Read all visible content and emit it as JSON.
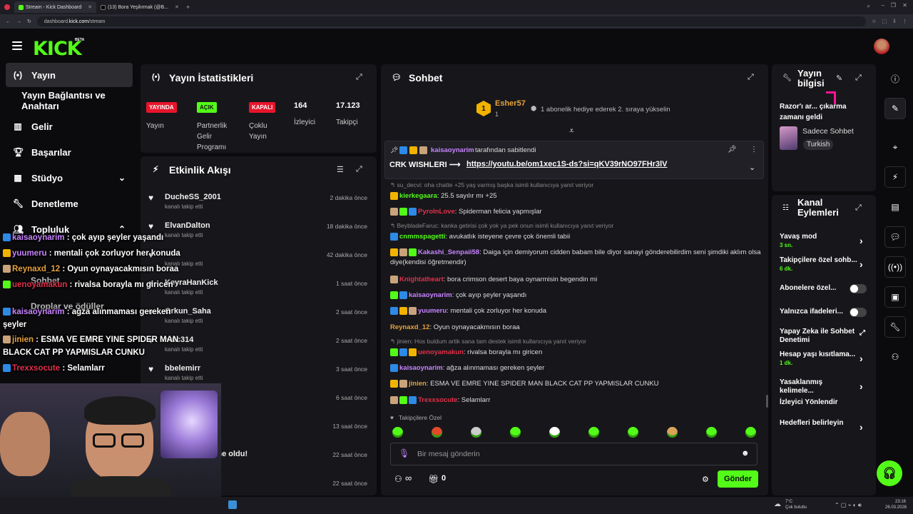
{
  "browser": {
    "tabs": [
      {
        "label": "Stream - Kick Dashboard",
        "active": true
      },
      {
        "label": "(13) Bora Yeşilırmak (@B...",
        "active": false
      }
    ],
    "url_prefix": "dashboard.",
    "url_host": "kick.com",
    "url_path": "/stream"
  },
  "logo": {
    "text": "KICK",
    "beta": "BETA"
  },
  "sidebar": {
    "items": [
      {
        "label": "Yayın",
        "icon": "broadcast-icon"
      },
      {
        "label": "Yayın Bağlantısı ve Anahtarı",
        "icon": ""
      },
      {
        "label": "Gelir",
        "icon": "bar-chart-icon"
      },
      {
        "label": "Başarılar",
        "icon": "trophy-icon"
      },
      {
        "label": "Stüdyo",
        "icon": "grid-icon"
      },
      {
        "label": "Denetleme",
        "icon": "wrench-icon"
      },
      {
        "label": "Topluluk",
        "icon": "users-icon"
      },
      {
        "label": "Sohbet",
        "icon": ""
      },
      {
        "label": "Droplar ve ödüller",
        "icon": ""
      }
    ]
  },
  "stats": {
    "title": "Yayın İstatistikleri",
    "live_badge": "YAYINDA",
    "live_label": "Yayın",
    "partner_badge": "AÇIK",
    "partner_label_1": "Partnerlik",
    "partner_label_2": "Gelir",
    "partner_label_3": "Programı",
    "multi_badge": "KAPALI",
    "multi_label_1": "Çoklu",
    "multi_label_2": "Yayın",
    "viewers_value": "164",
    "viewers_label": "İzleyici",
    "followers_value": "17.123",
    "followers_label": "Takipçi"
  },
  "activity": {
    "title": "Etkinlik Akışı",
    "rows": [
      {
        "name": "DucheSS_2001",
        "sub": "kanalı takip etti",
        "time": "2 dakika önce"
      },
      {
        "name": "ElvanDalton",
        "sub": "kanalı takip etti",
        "time": "18 dakika önce"
      },
      {
        "name": "",
        "sub": "kanalı takip etti",
        "time": "42 dakika önce"
      },
      {
        "name": "KeyraHanKick",
        "sub": "kanalı takip etti",
        "time": "1 saat önce"
      },
      {
        "name": "Orkun_Saha",
        "sub": "kanalı takip etti",
        "time": "2 saat önce"
      },
      {
        "name": "Yalc314",
        "sub": "kanalı takip etti",
        "time": "2 saat önce"
      },
      {
        "name": "bbelemirr",
        "sub": "kanalı takip etti",
        "time": "3 saat önce"
      },
      {
        "name": "",
        "sub": "",
        "time": "6 saat önce"
      },
      {
        "name": "",
        "sub": "",
        "time": "13 saat önce"
      },
      {
        "name": "...yeniden abone oldu!",
        "sub": "...ılar",
        "time": "22 saat önce"
      },
      {
        "name": "",
        "sub": "",
        "time": "22 saat önce"
      }
    ]
  },
  "chat": {
    "title": "Sohbet",
    "top_gifter_name": "Esher57",
    "top_gifter_count": "1",
    "top_gifter_rank": "1",
    "gift_hint": "1 abonelik hediye ederek 2. sıraya yükselin",
    "pinned_by_user": "kaisaoynarim",
    "pinned_by_text": "tarafından sabitlendi",
    "pinned_text": "CRK WISHLERI ⟶",
    "pinned_link": "https://youtu.be/om1xec1S-ds?si=qKV39rNO97FHr3lV",
    "messages": [
      {
        "reply": "su_decvi: oha chatte +25 yaş varmış başka isimli kullanıcıya yanıt veriyor"
      },
      {
        "user": "kierkegaara",
        "color": "#53fc18",
        "text": ": 25.5 sayılır mı +25"
      },
      {
        "user": "PyroInLove",
        "color": "#e0304a",
        "text": ": Spiderman felicia yapmışlar"
      },
      {
        "reply": "BeybladeFaruc: kanka getirisi çok yok ya pek onun isimli kullanıcıya yanıt veriyor"
      },
      {
        "user": "cnmmspagetti",
        "color": "#53fc18",
        "text": ": avukatlık isteyene çevre çok önemli tabii"
      },
      {
        "user": "Kakashi_Senpaii58",
        "color": "#c783ff",
        "text": ": Daiga için demiyorum cidden babam bile diyor sanayi gönderebilirdim seni şimdiki aklım olsa diye(kendisi öğretmendir)"
      },
      {
        "user": "Knightatheart",
        "color": "#e0304a",
        "text": ": bora crimson desert baya oynarmisin begendin mi"
      },
      {
        "user": "kaisaoynarim",
        "color": "#c783ff",
        "text": ": çok ayıp şeyler yaşandı"
      },
      {
        "user": "yuumeru",
        "color": "#c783ff",
        "text": ": mentali çok zorluyor her konuda"
      },
      {
        "user": "Reynaxd_12",
        "color": "#e6a23c",
        "text": ": Oyun oynayacakmısın boraa"
      },
      {
        "reply": "jinien: Hos buldum artik sana tam destek isimli kullanıcıya yanıt veriyor"
      },
      {
        "user": "uenoyamakun",
        "color": "#e0304a",
        "text": ": rivalsa borayla mı giricen"
      },
      {
        "user": "kaisaoynarim",
        "color": "#c783ff",
        "text": ": ağza alınmaması gereken şeyler"
      },
      {
        "user": "jinien",
        "color": "#e6a23c",
        "text": ": ESMA VE EMRE YINE SPIDER MAN BLACK CAT PP YAPMISLAR CUNKU"
      },
      {
        "user": "Trexxsocute",
        "color": "#e0304a",
        "text": ": Selamlarr"
      }
    ],
    "emote_section": "Takipçilere Özel",
    "input_placeholder": "Bir mesaj gönderin",
    "points": "∞",
    "gift_count": "0",
    "send_label": "Gönder"
  },
  "overlay_chat": [
    {
      "user": "kaisaoynarim",
      "color": "#c783ff",
      "text": " : çok ayıp şeyler yaşandı"
    },
    {
      "user": "yuumeru",
      "color": "#c783ff",
      "text": " : mentali çok zorluyor her konuda"
    },
    {
      "user": "Reynaxd_12",
      "color": "#e6a23c",
      "text": " : Oyun oynayacakmısın boraa"
    },
    {
      "user": "uenoyamakun",
      "color": "#e0304a",
      "text": " : rivalsa borayla mı giricen"
    },
    {
      "user": "kaisaoynarim",
      "color": "#c783ff",
      "text": " : ağza alınmaması gereken"
    },
    {
      "user": "",
      "color": "#fff",
      "text": "şeyler"
    },
    {
      "user": "jinien",
      "color": "#e6a23c",
      "text": " : ESMA VE EMRE YINE SPIDER MAN"
    },
    {
      "user": "",
      "color": "#fff",
      "text": "BLACK CAT PP YAPMISLAR CUNKU"
    },
    {
      "user": "Trexxsocute",
      "color": "#e0304a",
      "text": " : Selamlarr"
    }
  ],
  "stream_info": {
    "title_1": "Yayın",
    "title_2": "bilgisi",
    "stream_title": "Razor'ı ar... çıkarma zamanı geldi",
    "category": "Sadece Sohbet",
    "language": "Turkish"
  },
  "channel_actions": {
    "title_1": "Kanal",
    "title_2": "Eylemleri",
    "items": [
      {
        "label": "Yavaş mod",
        "sub": "3 sn."
      },
      {
        "label": "Takipçilere özel sohb...",
        "sub": "6 dk."
      },
      {
        "label": "Abonelere özel...",
        "sub": ""
      },
      {
        "label": "Yalnızca ifadeleri...",
        "sub": ""
      },
      {
        "label": "Yapay Zeka ile Sohbet Denetimi",
        "sub": ""
      },
      {
        "label": "Hesap yaşı kısıtlama...",
        "sub": "1 dk."
      },
      {
        "label": "Yasaklanmış kelimele...",
        "sub": ""
      },
      {
        "label": "İzleyici Yönlendir",
        "sub": ""
      },
      {
        "label": "Hedefleri belirleyin",
        "sub": ""
      }
    ]
  },
  "taskbar": {
    "weather_temp": "7°C",
    "weather_desc": "Çok bulutlu",
    "time": "23:16",
    "date": "26.03.2026"
  },
  "colors": {
    "accent": "#53fc18",
    "live": "#e8142b",
    "panel": "#17171b"
  }
}
